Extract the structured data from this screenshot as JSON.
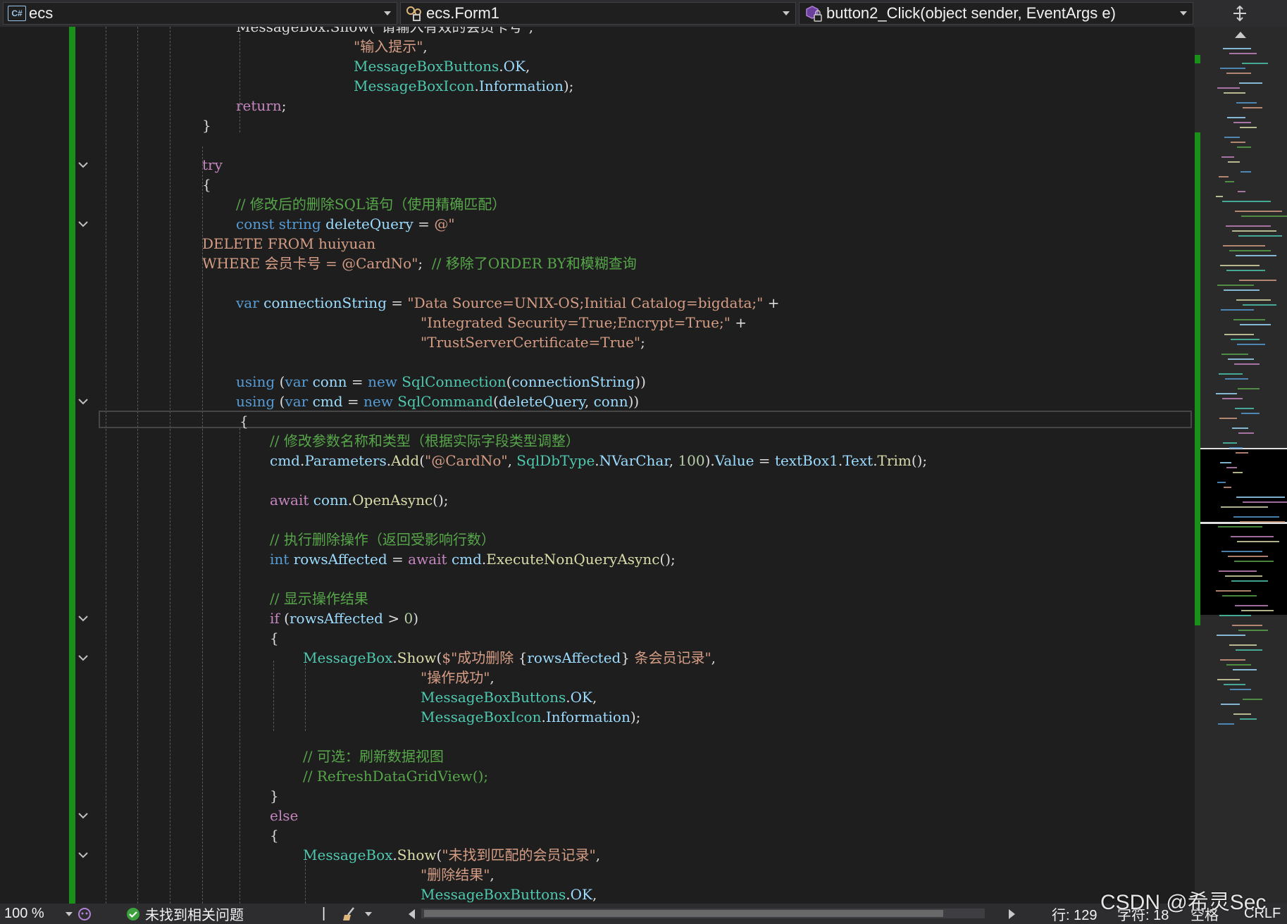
{
  "navbar": {
    "project": {
      "badge": "C#",
      "label": "ecs"
    },
    "class": {
      "label": "ecs.Form1"
    },
    "member": {
      "label": "button2_Click(object sender, EventArgs e)"
    }
  },
  "code": [
    [
      [
        "pl",
        "MessageBox.Show(\"请输入有效的会员卡号\","
      ]
    ],
    [
      [
        "st",
        "\"输入提示\""
      ],
      [
        "pl",
        ","
      ]
    ],
    [
      [
        "tp",
        "MessageBoxButtons"
      ],
      [
        "pl",
        "."
      ],
      [
        "vr",
        "OK"
      ],
      [
        "pl",
        ","
      ]
    ],
    [
      [
        "tp",
        "MessageBoxIcon"
      ],
      [
        "pl",
        "."
      ],
      [
        "vr",
        "Information"
      ],
      [
        "pl",
        ");"
      ]
    ],
    [
      [
        "kw",
        "return"
      ],
      [
        "pl",
        ";"
      ]
    ],
    [
      [
        "pl",
        "}"
      ]
    ],
    [],
    [
      [
        "kw",
        "try"
      ]
    ],
    [
      [
        "pl",
        "{"
      ]
    ],
    [
      [
        "cm",
        "// 修改后的删除SQL语句（使用精确匹配）"
      ]
    ],
    [
      [
        "kb",
        "const"
      ],
      [
        "pl",
        " "
      ],
      [
        "kb",
        "string"
      ],
      [
        "pl",
        " "
      ],
      [
        "vr",
        "deleteQuery"
      ],
      [
        "pl",
        " = "
      ],
      [
        "st",
        "@\""
      ]
    ],
    [
      [
        "st",
        "DELETE FROM huiyuan"
      ]
    ],
    [
      [
        "st",
        "WHERE 会员卡号 = @CardNo\""
      ],
      [
        "pl",
        ";  "
      ],
      [
        "cm",
        "// 移除了ORDER BY和模糊查询"
      ]
    ],
    [],
    [
      [
        "kb",
        "var"
      ],
      [
        "pl",
        " "
      ],
      [
        "vr",
        "connectionString"
      ],
      [
        "pl",
        " = "
      ],
      [
        "st",
        "\"Data Source=UNIX-OS;Initial Catalog=bigdata;\""
      ],
      [
        "pl",
        " +"
      ]
    ],
    [
      [
        "st",
        "\"Integrated Security=True;Encrypt=True;\""
      ],
      [
        "pl",
        " +"
      ]
    ],
    [
      [
        "st",
        "\"TrustServerCertificate=True\""
      ],
      [
        "pl",
        ";"
      ]
    ],
    [],
    [
      [
        "kb",
        "using"
      ],
      [
        "pl",
        " ("
      ],
      [
        "kb",
        "var"
      ],
      [
        "pl",
        " "
      ],
      [
        "vr",
        "conn"
      ],
      [
        "pl",
        " = "
      ],
      [
        "kb",
        "new"
      ],
      [
        "pl",
        " "
      ],
      [
        "tp",
        "SqlConnection"
      ],
      [
        "pl",
        "("
      ],
      [
        "vr",
        "connectionString"
      ],
      [
        "pl",
        "))"
      ]
    ],
    [
      [
        "kb",
        "using"
      ],
      [
        "pl",
        " ("
      ],
      [
        "kb",
        "var"
      ],
      [
        "pl",
        " "
      ],
      [
        "vr",
        "cmd"
      ],
      [
        "pl",
        " = "
      ],
      [
        "kb",
        "new"
      ],
      [
        "pl",
        " "
      ],
      [
        "tp",
        "SqlCommand"
      ],
      [
        "pl",
        "("
      ],
      [
        "vr",
        "deleteQuery"
      ],
      [
        "pl",
        ", "
      ],
      [
        "vr",
        "conn"
      ],
      [
        "pl",
        "))"
      ]
    ],
    [
      [
        "pl",
        "{"
      ]
    ],
    [
      [
        "cm",
        "// 修改参数名称和类型（根据实际字段类型调整）"
      ]
    ],
    [
      [
        "vr",
        "cmd"
      ],
      [
        "pl",
        "."
      ],
      [
        "vr",
        "Parameters"
      ],
      [
        "pl",
        "."
      ],
      [
        "fn",
        "Add"
      ],
      [
        "pl",
        "("
      ],
      [
        "st",
        "\"@CardNo\""
      ],
      [
        "pl",
        ", "
      ],
      [
        "tp",
        "SqlDbType"
      ],
      [
        "pl",
        "."
      ],
      [
        "vr",
        "NVarChar"
      ],
      [
        "pl",
        ", "
      ],
      [
        "nm",
        "100"
      ],
      [
        "pl",
        ")."
      ],
      [
        "vr",
        "Value"
      ],
      [
        "pl",
        " = "
      ],
      [
        "vr",
        "textBox1"
      ],
      [
        "pl",
        "."
      ],
      [
        "vr",
        "Text"
      ],
      [
        "pl",
        "."
      ],
      [
        "fn",
        "Trim"
      ],
      [
        "pl",
        "();"
      ]
    ],
    [],
    [
      [
        "kw",
        "await"
      ],
      [
        "pl",
        " "
      ],
      [
        "vr",
        "conn"
      ],
      [
        "pl",
        "."
      ],
      [
        "fn",
        "OpenAsync"
      ],
      [
        "pl",
        "();"
      ]
    ],
    [],
    [
      [
        "cm",
        "// 执行删除操作（返回受影响行数）"
      ]
    ],
    [
      [
        "kb",
        "int"
      ],
      [
        "pl",
        " "
      ],
      [
        "vr",
        "rowsAffected"
      ],
      [
        "pl",
        " = "
      ],
      [
        "kw",
        "await"
      ],
      [
        "pl",
        " "
      ],
      [
        "vr",
        "cmd"
      ],
      [
        "pl",
        "."
      ],
      [
        "fn",
        "ExecuteNonQueryAsync"
      ],
      [
        "pl",
        "();"
      ]
    ],
    [],
    [
      [
        "cm",
        "// 显示操作结果"
      ]
    ],
    [
      [
        "kw",
        "if"
      ],
      [
        "pl",
        " ("
      ],
      [
        "vr",
        "rowsAffected"
      ],
      [
        "pl",
        " > "
      ],
      [
        "nm",
        "0"
      ],
      [
        "pl",
        ")"
      ]
    ],
    [
      [
        "pl",
        "{"
      ]
    ],
    [
      [
        "tp",
        "MessageBox"
      ],
      [
        "pl",
        "."
      ],
      [
        "fn",
        "Show"
      ],
      [
        "pl",
        "("
      ],
      [
        "st",
        "$\"成功删除 "
      ],
      [
        "pl",
        "{"
      ],
      [
        "vr",
        "rowsAffected"
      ],
      [
        "pl",
        "}"
      ],
      [
        "st",
        " 条会员记录\""
      ],
      [
        "pl",
        ","
      ]
    ],
    [
      [
        "st",
        "\"操作成功\""
      ],
      [
        "pl",
        ","
      ]
    ],
    [
      [
        "tp",
        "MessageBoxButtons"
      ],
      [
        "pl",
        "."
      ],
      [
        "vr",
        "OK"
      ],
      [
        "pl",
        ","
      ]
    ],
    [
      [
        "tp",
        "MessageBoxIcon"
      ],
      [
        "pl",
        "."
      ],
      [
        "vr",
        "Information"
      ],
      [
        "pl",
        ");"
      ]
    ],
    [],
    [
      [
        "cm",
        "// 可选：刷新数据视图"
      ]
    ],
    [
      [
        "cm",
        "// RefreshDataGridView();"
      ]
    ],
    [
      [
        "pl",
        "}"
      ]
    ],
    [
      [
        "kw",
        "else"
      ]
    ],
    [
      [
        "pl",
        "{"
      ]
    ],
    [
      [
        "tp",
        "MessageBox"
      ],
      [
        "pl",
        "."
      ],
      [
        "fn",
        "Show"
      ],
      [
        "pl",
        "("
      ],
      [
        "st",
        "\"未找到匹配的会员记录\""
      ],
      [
        "pl",
        ","
      ]
    ],
    [
      [
        "st",
        "\"删除结果\""
      ],
      [
        "pl",
        ","
      ]
    ],
    [
      [
        "tp",
        "MessageBoxButtons"
      ],
      [
        "pl",
        "."
      ],
      [
        "vr",
        "OK"
      ],
      [
        "pl",
        ","
      ]
    ]
  ],
  "statusbar": {
    "zoom": "100 %",
    "issues": "未找到相关问题",
    "line": "行: 129",
    "char": "字符: 18",
    "spacing": "空格",
    "eol": "CRLF",
    "watermark": "CSDN @希灵Sec"
  }
}
